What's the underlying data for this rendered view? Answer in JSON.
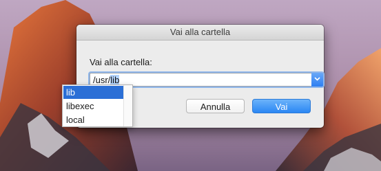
{
  "dialog": {
    "title": "Vai alla cartella",
    "prompt": "Vai alla cartella:",
    "path_prefix": "/usr/",
    "path_selected": "lib",
    "cancel_label": "Annulla",
    "go_label": "Vai"
  },
  "suggestions": {
    "items": [
      {
        "label": "lib",
        "selected": true
      },
      {
        "label": "libexec",
        "selected": false
      },
      {
        "label": "local",
        "selected": false
      }
    ]
  },
  "colors": {
    "accent": "#2a86f3",
    "selection": "#b3d3fc",
    "menu_highlight": "#2b6fd6"
  }
}
